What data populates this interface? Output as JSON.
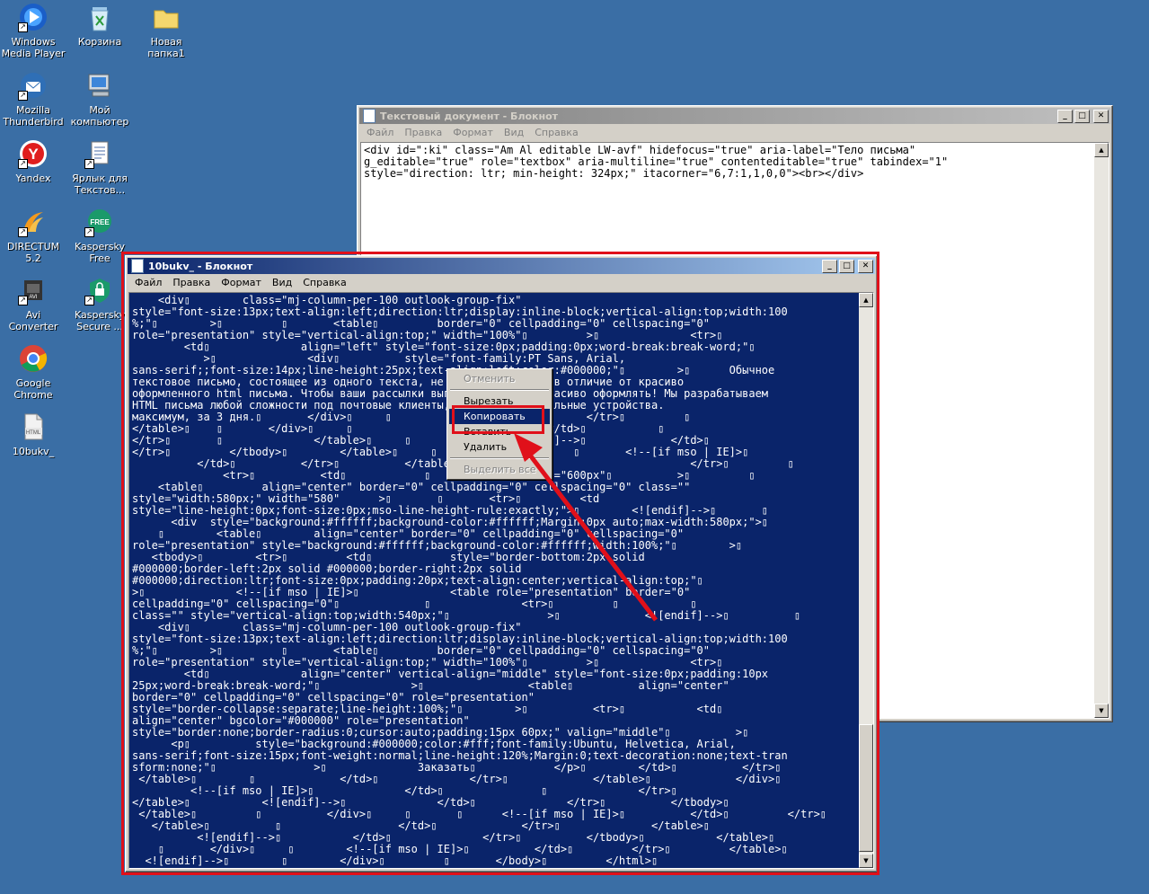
{
  "desktop": {
    "icons": [
      {
        "label": "Windows Media Player",
        "icon": "media-player-icon"
      },
      {
        "label": "Корзина",
        "icon": "recycle-bin-icon"
      },
      {
        "label": "Новая папка1",
        "icon": "folder-icon"
      },
      {
        "label": "Mozilla Thunderbird",
        "icon": "thunderbird-icon"
      },
      {
        "label": "Мой компьютер",
        "icon": "my-computer-icon"
      },
      {
        "label": "Yandex",
        "icon": "yandex-icon"
      },
      {
        "label": "Ярлык для Текстов...",
        "icon": "text-shortcut-icon"
      },
      {
        "label": "DIRECTUM 5.2",
        "icon": "directum-icon"
      },
      {
        "label": "Kaspersky Free",
        "icon": "kaspersky-free-icon"
      },
      {
        "label": "Avi Converter",
        "icon": "avi-converter-icon"
      },
      {
        "label": "Kaspersky Secure ...",
        "icon": "kaspersky-secure-icon"
      },
      {
        "label": "Google Chrome",
        "icon": "chrome-icon"
      },
      {
        "label": "10bukv_",
        "icon": "html-file-icon"
      }
    ]
  },
  "back_window": {
    "title": "Текстовый документ - Блокнот",
    "menu": [
      "Файл",
      "Правка",
      "Формат",
      "Вид",
      "Справка"
    ],
    "text": "<div id=\":ki\" class=\"Am Al editable LW-avf\" hidefocus=\"true\" aria-label=\"Тело письма\"\ng_editable=\"true\" role=\"textbox\" aria-multiline=\"true\" contenteditable=\"true\" tabindex=\"1\"\nstyle=\"direction: ltr; min-height: 324px;\" itacorner=\"6,7:1,1,0,0\"><br></div>"
  },
  "front_window": {
    "title": "10bukv_ - Блокнот",
    "menu": [
      "Файл",
      "Правка",
      "Формат",
      "Вид",
      "Справка"
    ],
    "text": "    <div▯        class=\"mj-column-per-100 outlook-group-fix\"\nstyle=\"font-size:13px;text-align:left;direction:ltr;display:inline-block;vertical-align:top;width:100\n%;\"▯        >▯         ▯       <table▯         border=\"0\" cellpadding=\"0\" cellspacing=\"0\"\nrole=\"presentation\" style=\"vertical-align:top;\" width=\"100%\"▯         >▯              <tr>▯\n        <td▯              align=\"left\" style=\"font-size:0px;padding:0px;word-break:break-word;\"▯\n           >▯              <div▯          style=\"font-family:PT Sans, Arial,\nsans-serif;;font-size:14px;line-height:25px;text-align:left;color:#000000;\"▯        >▯      Обычное\nтекстовое письмо, состоящее из одного текста, не вызовет интерес в отличие от красиво\nоформленного html письма. Чтобы ваши рассылки выглядели, нужно красиво оформлять! Мы разрабатываем\nHTML письма любой сложности под почтовые клиенты, браузеры и мобильные устройства.\nмаксимум, за 3 дня.▯       </div>▯     ▯                              </tr>▯         ▯\n</table>▯    ▯       </div>▯     ▯                              </td>▯           ▯\n</tr>▯       ▯              </table>▯     ▯              <![endif]-->▯             </td>▯\n</tr>▯         </tbody>▯        </table>▯     ▯      </div>▯        ▯       <!--[if mso | IE]>▯\n          </td>▯          </tr>▯          </table>▯     ▯                             </tr>▯         ▯\n              <tr>▯          <td▯            ▯              width=\"600px\"▯          >▯         ▯\n    <table▯         align=\"center\" border=\"0\" cellpadding=\"0\" cellspacing=\"0\" class=\"\"\nstyle=\"width:580px;\" width=\"580\"      >▯       ▯       <tr>▯         <td\nstyle=\"line-height:0px;font-size:0px;mso-line-height-rule:exactly;\">▯        <![endif]-->▯       ▯\n      <div  style=\"background:#ffffff;background-color:#ffffff;Margin:0px auto;max-width:580px;\">▯\n    ▯        <table▯        align=\"center\" border=\"0\" cellpadding=\"0\" cellspacing=\"0\"\nrole=\"presentation\" style=\"background:#ffffff;background-color:#ffffff;width:100%;\"▯        >▯\n   <tbody>▯        <tr>▯         <td▯            style=\"border-bottom:2px solid\n#000000;border-left:2px solid #000000;border-right:2px solid\n#000000;direction:ltr;font-size:0px;padding:20px;text-align:center;vertical-align:top;\"▯\n>▯              <!--[if mso | IE]>▯              <table role=\"presentation\" border=\"0\"\ncellpadding=\"0\" cellspacing=\"0\"▯             ▯              <tr>▯         ▯           ▯\nclass=\"\" style=\"vertical-align:top;width:540px;\"▯               >▯             <![endif]-->▯          ▯\n    <div▯        class=\"mj-column-per-100 outlook-group-fix\"\nstyle=\"font-size:13px;text-align:left;direction:ltr;display:inline-block;vertical-align:top;width:100\n%;\"▯        >▯         ▯       <table▯         border=\"0\" cellpadding=\"0\" cellspacing=\"0\"\nrole=\"presentation\" style=\"vertical-align:top;\" width=\"100%\"▯         >▯              <tr>▯\n        <td▯              align=\"center\" vertical-align=\"middle\" style=\"font-size:0px;padding:10px\n25px;word-break:break-word;\"▯              >▯                <table▯          align=\"center\"\nborder=\"0\" cellpadding=\"0\" cellspacing=\"0\" role=\"presentation\"\nstyle=\"border-collapse:separate;line-height:100%;\"▯        >▯          <tr>▯           <td▯\nalign=\"center\" bgcolor=\"#000000\" role=\"presentation\"\nstyle=\"border:none;border-radius:0;cursor:auto;padding:15px 60px;\" valign=\"middle\"▯          >▯\n      <p▯          style=\"background:#000000;color:#fff;font-family:Ubuntu, Helvetica, Arial,\nsans-serif;font-size:15px;font-weight:normal;line-height:120%;Margin:0;text-decoration:none;text-tran\nsform:none;\"▯               >▯              Заказать▯            </p>▯        </td>▯          </tr>▯\n </table>▯        ▯             </td>▯              </tr>▯             </table>▯             </div>▯\n         <!--[if mso | IE]>▯              </td>▯               ▯              </tr>▯\n</table>▯           <![endif]-->▯              </td>▯              </tr>▯          </tbody>▯\n </table>▯         ▯          </div>▯     ▯       ▯      <!--[if mso | IE]>▯          </td>▯         </tr>▯\n   </table>▯          ▯                  </td>▯             </tr>▯              </table>▯\n          <![endif]-->▯           </td>▯              </tr>▯          </tbody>▯           </table>▯\n    ▯       </div>▯     ▯        <!--[if mso | IE]>▯          </td>▯         </tr>▯         </table>▯\n  <![endif]-->▯        ▯        </div>▯         ▯       </body>▯         </html>▯"
  },
  "context_menu": {
    "items": [
      {
        "label": "Отменить",
        "disabled": true
      },
      {
        "label": "Вырезать",
        "disabled": false
      },
      {
        "label": "Копировать",
        "disabled": false,
        "highlighted": true
      },
      {
        "label": "Вставить",
        "disabled": false
      },
      {
        "label": "Удалить",
        "disabled": false
      },
      {
        "label": "Выделить все",
        "disabled": true
      }
    ]
  },
  "colors": {
    "desktop": "#3a6ea5",
    "selection": "#0a246a",
    "annotation_red": "#e0101a"
  }
}
